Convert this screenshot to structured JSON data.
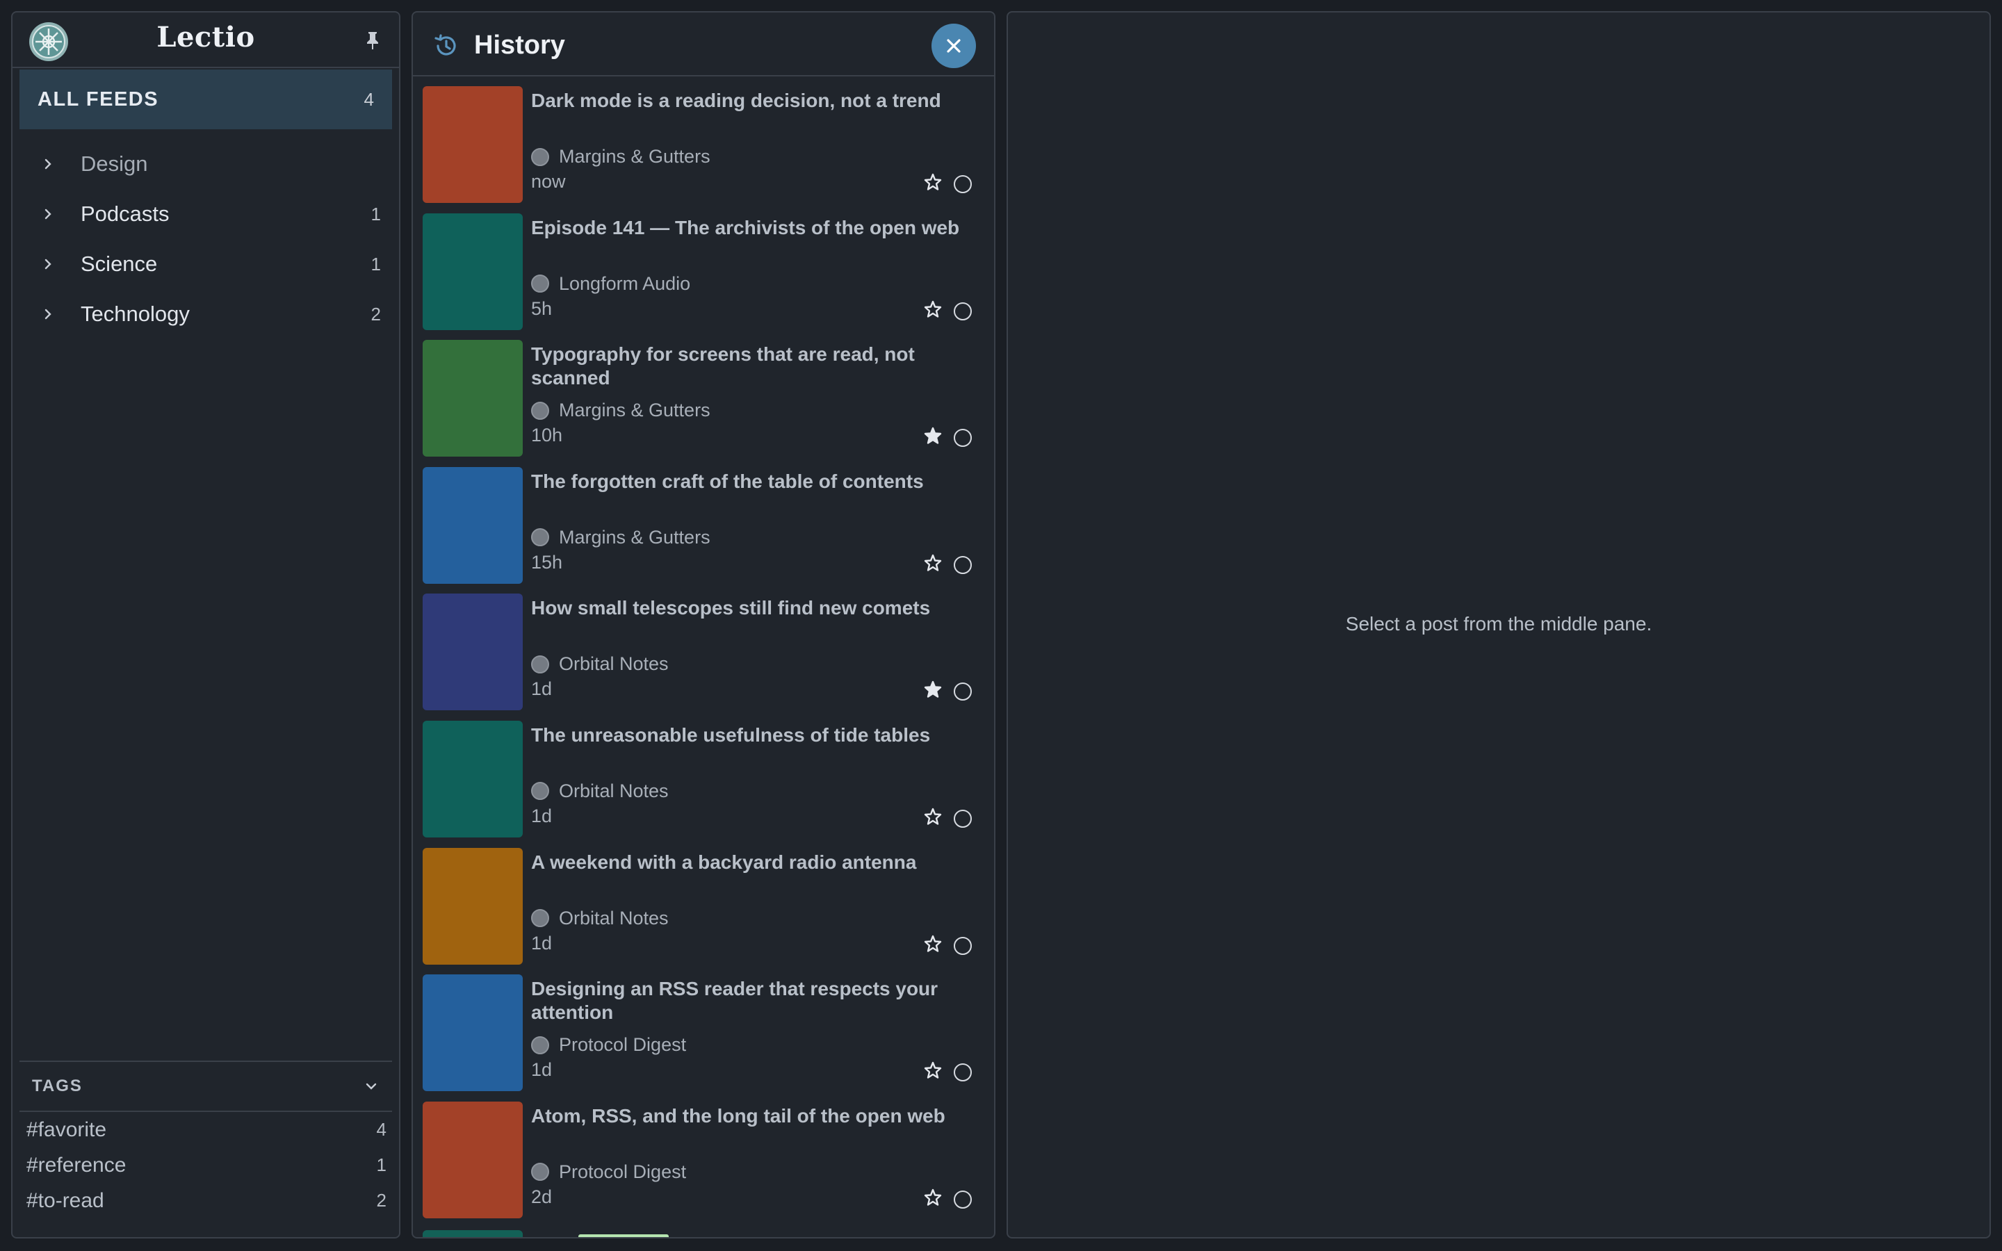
{
  "app": {
    "title": "Lectio"
  },
  "sidebar": {
    "all_feeds": {
      "label": "ALL FEEDS",
      "count": "4"
    },
    "feeds": [
      {
        "name": "Design",
        "count": ""
      },
      {
        "name": "Podcasts",
        "count": "1"
      },
      {
        "name": "Science",
        "count": "1"
      },
      {
        "name": "Technology",
        "count": "2"
      }
    ],
    "tags_label": "TAGS",
    "tags": [
      {
        "name": "#favorite",
        "count": "4"
      },
      {
        "name": "#reference",
        "count": "1"
      },
      {
        "name": "#to-read",
        "count": "2"
      }
    ]
  },
  "history": {
    "title": "History",
    "posts": [
      {
        "title": "Dark mode is a reading decision, not a trend",
        "source": "Margins & Gutters",
        "age": "now",
        "starred": false,
        "color": "#a34128"
      },
      {
        "title": "Episode 141 — The archivists of the open web",
        "source": "Longform Audio",
        "age": "5h",
        "starred": false,
        "color": "#0f615a"
      },
      {
        "title": "Typography for screens that are read, not scanned",
        "source": "Margins & Gutters",
        "age": "10h",
        "starred": true,
        "color": "#33703b"
      },
      {
        "title": "The forgotten craft of the table of contents",
        "source": "Margins & Gutters",
        "age": "15h",
        "starred": false,
        "color": "#24609d"
      },
      {
        "title": "How small telescopes still find new comets",
        "source": "Orbital Notes",
        "age": "1d",
        "starred": true,
        "color": "#2f3a78"
      },
      {
        "title": "The unreasonable usefulness of tide tables",
        "source": "Orbital Notes",
        "age": "1d",
        "starred": false,
        "color": "#0f615a"
      },
      {
        "title": "A weekend with a backyard radio antenna",
        "source": "Orbital Notes",
        "age": "1d",
        "starred": false,
        "color": "#a0630f"
      },
      {
        "title": "Designing an RSS reader that respects your attention",
        "source": "Protocol Digest",
        "age": "1d",
        "starred": false,
        "color": "#24609d"
      },
      {
        "title": "Atom, RSS, and the long tail of the open web",
        "source": "Protocol Digest",
        "age": "2d",
        "starred": false,
        "color": "#a34128"
      }
    ]
  },
  "reader": {
    "empty_message": "Select a post from the middle pane."
  }
}
